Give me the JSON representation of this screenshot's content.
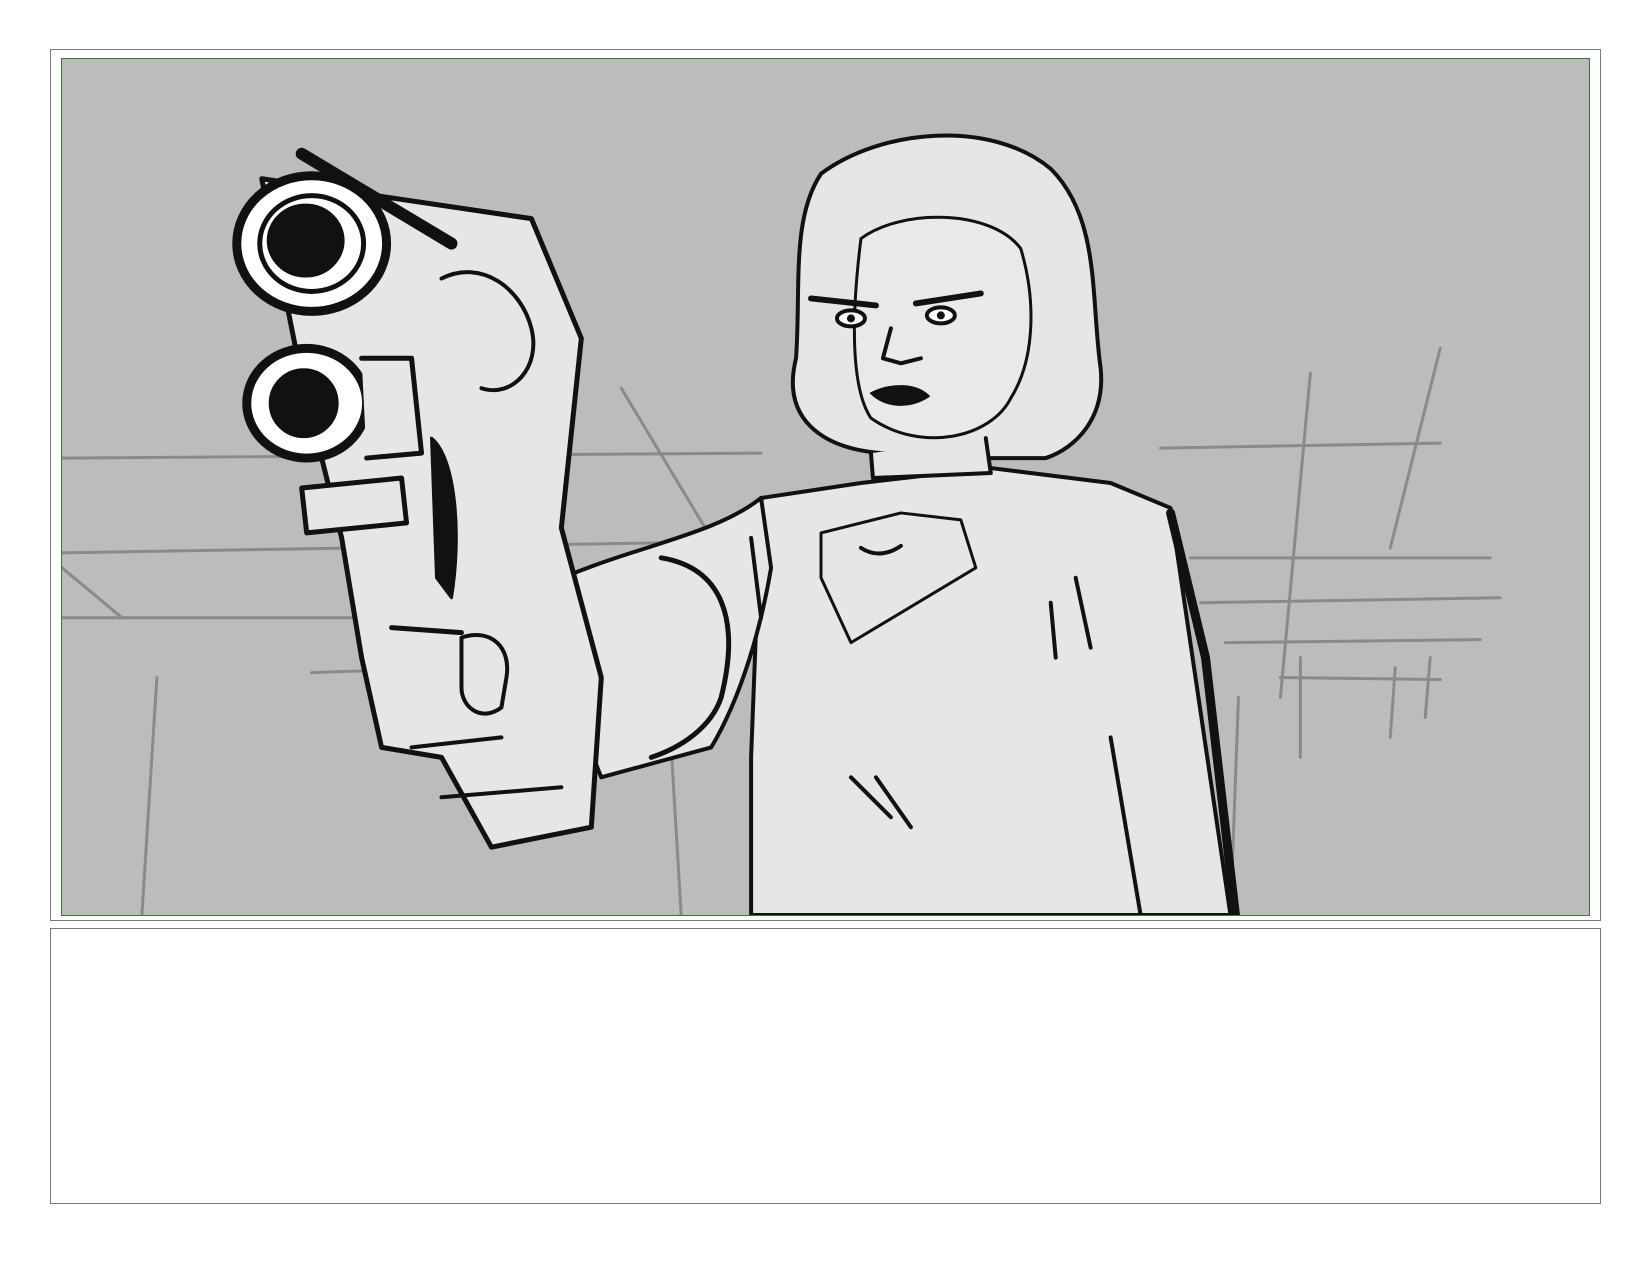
{
  "storyboard": {
    "panel": {
      "image_description_icon": "sketch-woman-aiming-pistol",
      "colors": {
        "background": "#bcbcbc",
        "figure_fill": "#e6e6e6",
        "ink": "#111111",
        "guide_lines": "#8a8a8a",
        "safe_area_border": "#2e7d32",
        "frame_border": "#7a7a7a"
      }
    },
    "notes": {
      "text": ""
    }
  }
}
